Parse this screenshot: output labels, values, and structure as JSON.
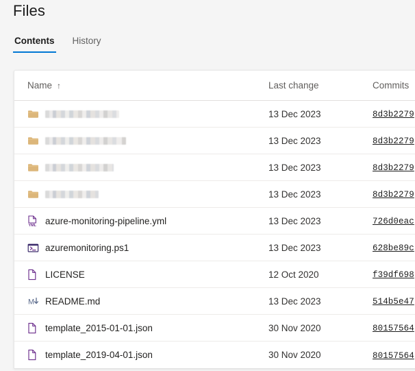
{
  "page": {
    "title": "Files"
  },
  "tabs": [
    {
      "label": "Contents",
      "active": true
    },
    {
      "label": "History",
      "active": false
    }
  ],
  "table": {
    "columns": {
      "name": "Name",
      "sort_indicator": "↑",
      "last_change": "Last change",
      "commits": "Commits"
    },
    "rows": [
      {
        "icon": "folder-icon",
        "name": "",
        "redacted": true,
        "redacted_width": 108,
        "last_change": "13 Dec 2023",
        "commit": "8d3b2279"
      },
      {
        "icon": "folder-icon",
        "name": "",
        "redacted": true,
        "redacted_width": 118,
        "last_change": "13 Dec 2023",
        "commit": "8d3b2279"
      },
      {
        "icon": "folder-icon",
        "name": "",
        "redacted": true,
        "redacted_width": 100,
        "last_change": "13 Dec 2023",
        "commit": "8d3b2279"
      },
      {
        "icon": "folder-icon",
        "name": "",
        "redacted": true,
        "redacted_width": 78,
        "last_change": "13 Dec 2023",
        "commit": "8d3b2279"
      },
      {
        "icon": "yml-file-icon",
        "name": "azure-monitoring-pipeline.yml",
        "redacted": false,
        "last_change": "13 Dec 2023",
        "commit": "726d0eac"
      },
      {
        "icon": "powershell-file-icon",
        "name": "azuremonitoring.ps1",
        "redacted": false,
        "last_change": "13 Dec 2023",
        "commit": "628be89c"
      },
      {
        "icon": "blank-file-icon",
        "name": "LICENSE",
        "redacted": false,
        "last_change": "12 Oct 2020",
        "commit": "f39df698"
      },
      {
        "icon": "markdown-file-icon",
        "name": "README.md",
        "redacted": false,
        "last_change": "13 Dec 2023",
        "commit": "514b5e47"
      },
      {
        "icon": "blank-file-icon",
        "name": "template_2015-01-01.json",
        "redacted": false,
        "last_change": "30 Nov 2020",
        "commit": "80157564"
      },
      {
        "icon": "blank-file-icon",
        "name": "template_2019-04-01.json",
        "redacted": false,
        "last_change": "30 Nov 2020",
        "commit": "80157564"
      }
    ]
  },
  "colors": {
    "accent": "#0078d4",
    "folder": "#dcb67a",
    "file_outline": "#6b2d8c",
    "markdown": "#5b6b8c",
    "page_background": "#f5f5f5",
    "card_background": "#ffffff",
    "row_divider": "#edebe9"
  }
}
